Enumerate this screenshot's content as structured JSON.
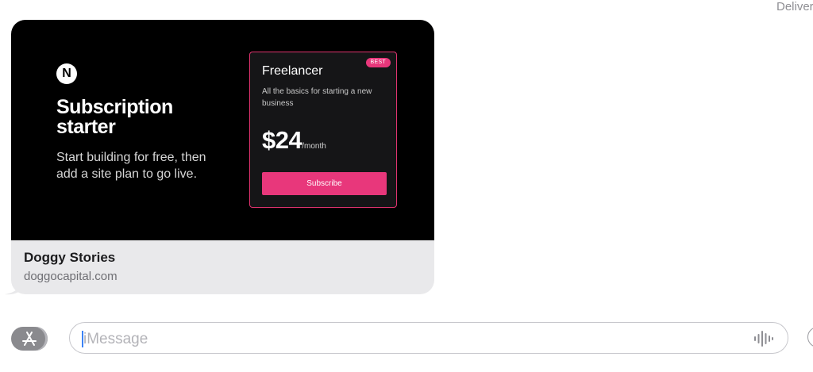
{
  "status": {
    "delivered": "Delivered"
  },
  "link_preview": {
    "logo_letter": "N",
    "hero_title": "Subscription starter",
    "hero_subtitle": "Start building for free, then add a site plan to go live.",
    "plan_card": {
      "badge": "BEST",
      "name": "Freelancer",
      "description": "All the basics for starting a new business",
      "price": "$24",
      "period": "/month",
      "button_label": "Subscribe"
    },
    "site_title": "Doggy Stories",
    "site_domain": "doggocapital.com"
  },
  "composer": {
    "placeholder": "iMessage",
    "apps_icon": "app-store-icon",
    "voice_icon": "waveform-icon"
  },
  "colors": {
    "accent": "#e8377b",
    "bubble": "#e9e9eb",
    "caret": "#3b82f6"
  }
}
